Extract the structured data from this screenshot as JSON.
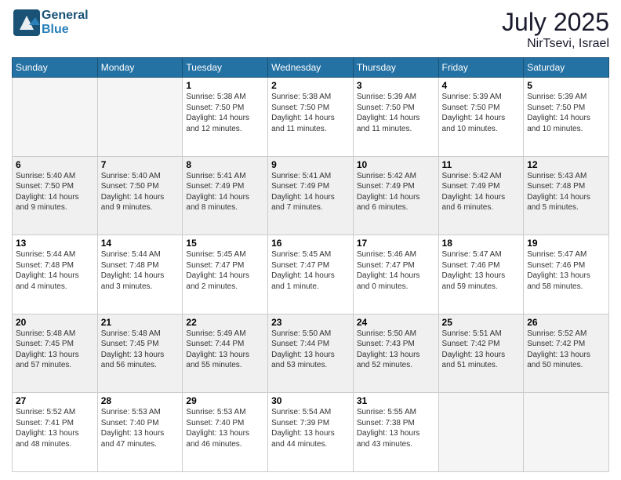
{
  "header": {
    "logo_line1": "General",
    "logo_line2": "Blue",
    "month": "July 2025",
    "location": "NirTsevi, Israel"
  },
  "days_of_week": [
    "Sunday",
    "Monday",
    "Tuesday",
    "Wednesday",
    "Thursday",
    "Friday",
    "Saturday"
  ],
  "weeks": [
    [
      {
        "day": "",
        "info": ""
      },
      {
        "day": "",
        "info": ""
      },
      {
        "day": "1",
        "info": "Sunrise: 5:38 AM\nSunset: 7:50 PM\nDaylight: 14 hours\nand 12 minutes."
      },
      {
        "day": "2",
        "info": "Sunrise: 5:38 AM\nSunset: 7:50 PM\nDaylight: 14 hours\nand 11 minutes."
      },
      {
        "day": "3",
        "info": "Sunrise: 5:39 AM\nSunset: 7:50 PM\nDaylight: 14 hours\nand 11 minutes."
      },
      {
        "day": "4",
        "info": "Sunrise: 5:39 AM\nSunset: 7:50 PM\nDaylight: 14 hours\nand 10 minutes."
      },
      {
        "day": "5",
        "info": "Sunrise: 5:39 AM\nSunset: 7:50 PM\nDaylight: 14 hours\nand 10 minutes."
      }
    ],
    [
      {
        "day": "6",
        "info": "Sunrise: 5:40 AM\nSunset: 7:50 PM\nDaylight: 14 hours\nand 9 minutes."
      },
      {
        "day": "7",
        "info": "Sunrise: 5:40 AM\nSunset: 7:50 PM\nDaylight: 14 hours\nand 9 minutes."
      },
      {
        "day": "8",
        "info": "Sunrise: 5:41 AM\nSunset: 7:49 PM\nDaylight: 14 hours\nand 8 minutes."
      },
      {
        "day": "9",
        "info": "Sunrise: 5:41 AM\nSunset: 7:49 PM\nDaylight: 14 hours\nand 7 minutes."
      },
      {
        "day": "10",
        "info": "Sunrise: 5:42 AM\nSunset: 7:49 PM\nDaylight: 14 hours\nand 6 minutes."
      },
      {
        "day": "11",
        "info": "Sunrise: 5:42 AM\nSunset: 7:49 PM\nDaylight: 14 hours\nand 6 minutes."
      },
      {
        "day": "12",
        "info": "Sunrise: 5:43 AM\nSunset: 7:48 PM\nDaylight: 14 hours\nand 5 minutes."
      }
    ],
    [
      {
        "day": "13",
        "info": "Sunrise: 5:44 AM\nSunset: 7:48 PM\nDaylight: 14 hours\nand 4 minutes."
      },
      {
        "day": "14",
        "info": "Sunrise: 5:44 AM\nSunset: 7:48 PM\nDaylight: 14 hours\nand 3 minutes."
      },
      {
        "day": "15",
        "info": "Sunrise: 5:45 AM\nSunset: 7:47 PM\nDaylight: 14 hours\nand 2 minutes."
      },
      {
        "day": "16",
        "info": "Sunrise: 5:45 AM\nSunset: 7:47 PM\nDaylight: 14 hours\nand 1 minute."
      },
      {
        "day": "17",
        "info": "Sunrise: 5:46 AM\nSunset: 7:47 PM\nDaylight: 14 hours\nand 0 minutes."
      },
      {
        "day": "18",
        "info": "Sunrise: 5:47 AM\nSunset: 7:46 PM\nDaylight: 13 hours\nand 59 minutes."
      },
      {
        "day": "19",
        "info": "Sunrise: 5:47 AM\nSunset: 7:46 PM\nDaylight: 13 hours\nand 58 minutes."
      }
    ],
    [
      {
        "day": "20",
        "info": "Sunrise: 5:48 AM\nSunset: 7:45 PM\nDaylight: 13 hours\nand 57 minutes."
      },
      {
        "day": "21",
        "info": "Sunrise: 5:48 AM\nSunset: 7:45 PM\nDaylight: 13 hours\nand 56 minutes."
      },
      {
        "day": "22",
        "info": "Sunrise: 5:49 AM\nSunset: 7:44 PM\nDaylight: 13 hours\nand 55 minutes."
      },
      {
        "day": "23",
        "info": "Sunrise: 5:50 AM\nSunset: 7:44 PM\nDaylight: 13 hours\nand 53 minutes."
      },
      {
        "day": "24",
        "info": "Sunrise: 5:50 AM\nSunset: 7:43 PM\nDaylight: 13 hours\nand 52 minutes."
      },
      {
        "day": "25",
        "info": "Sunrise: 5:51 AM\nSunset: 7:42 PM\nDaylight: 13 hours\nand 51 minutes."
      },
      {
        "day": "26",
        "info": "Sunrise: 5:52 AM\nSunset: 7:42 PM\nDaylight: 13 hours\nand 50 minutes."
      }
    ],
    [
      {
        "day": "27",
        "info": "Sunrise: 5:52 AM\nSunset: 7:41 PM\nDaylight: 13 hours\nand 48 minutes."
      },
      {
        "day": "28",
        "info": "Sunrise: 5:53 AM\nSunset: 7:40 PM\nDaylight: 13 hours\nand 47 minutes."
      },
      {
        "day": "29",
        "info": "Sunrise: 5:53 AM\nSunset: 7:40 PM\nDaylight: 13 hours\nand 46 minutes."
      },
      {
        "day": "30",
        "info": "Sunrise: 5:54 AM\nSunset: 7:39 PM\nDaylight: 13 hours\nand 44 minutes."
      },
      {
        "day": "31",
        "info": "Sunrise: 5:55 AM\nSunset: 7:38 PM\nDaylight: 13 hours\nand 43 minutes."
      },
      {
        "day": "",
        "info": ""
      },
      {
        "day": "",
        "info": ""
      }
    ]
  ]
}
